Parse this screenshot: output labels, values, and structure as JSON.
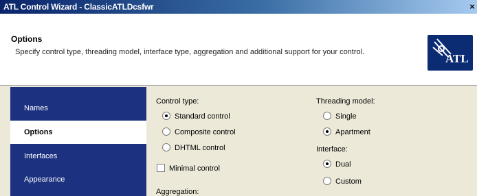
{
  "window": {
    "title": "ATL Control Wizard - ClassicATLDcsfwr",
    "close_glyph": "×"
  },
  "header": {
    "title": "Options",
    "description": "Specify control type, threading model, interface type, aggregation and additional support for your control.",
    "logo_text": "ATL"
  },
  "sidebar": {
    "items": [
      {
        "label": "Names",
        "selected": false
      },
      {
        "label": "Options",
        "selected": true
      },
      {
        "label": "Interfaces",
        "selected": false
      },
      {
        "label": "Appearance",
        "selected": false
      }
    ]
  },
  "control_type": {
    "label": "Control type:",
    "options": [
      {
        "label": "Standard control",
        "checked": true
      },
      {
        "label": "Composite control",
        "checked": false
      },
      {
        "label": "DHTML control",
        "checked": false
      }
    ]
  },
  "minimal_control": {
    "label": "Minimal control",
    "checked": false
  },
  "aggregation": {
    "label": "Aggregation:"
  },
  "threading_model": {
    "label": "Threading model:",
    "options": [
      {
        "label": "Single",
        "checked": false
      },
      {
        "label": "Apartment",
        "checked": true
      }
    ]
  },
  "interface": {
    "label": "Interface:",
    "options": [
      {
        "label": "Dual",
        "checked": true
      },
      {
        "label": "Custom",
        "checked": false
      }
    ]
  }
}
